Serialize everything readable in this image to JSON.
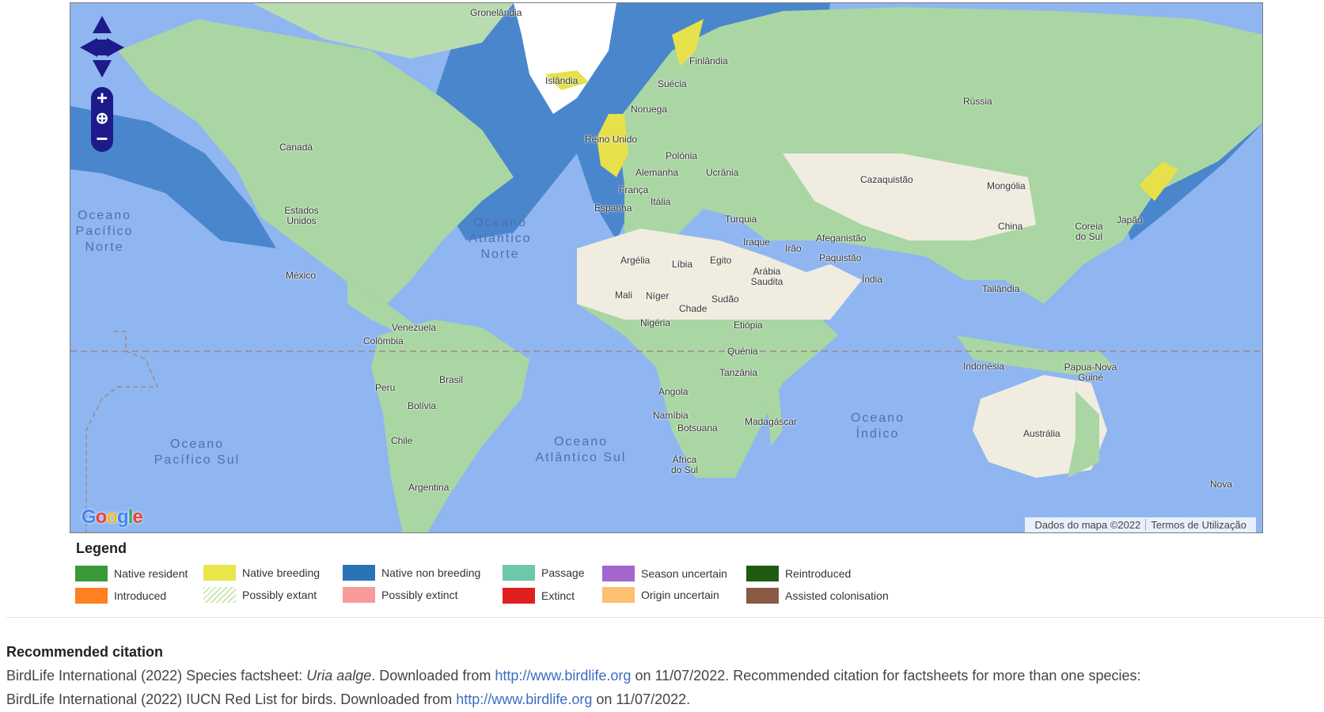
{
  "map": {
    "countries": [
      "Gronelândia",
      "Islândia",
      "Finlândia",
      "Suécia",
      "Noruega",
      "Reino Unido",
      "Polónia",
      "Alemanha",
      "Ucrânia",
      "França",
      "Itália",
      "Espanha",
      "Rússia",
      "Cazaquistão",
      "Mongólia",
      "China",
      "Coreia do Sul",
      "Japão",
      "Turquia",
      "Iraque",
      "Irão",
      "Afeganistão",
      "Paquistão",
      "Arábia Saudita",
      "Índia",
      "Tailândia",
      "Egito",
      "Argélia",
      "Líbia",
      "Mali",
      "Níger",
      "Chade",
      "Sudão",
      "Nigéria",
      "Etiópia",
      "Quénia",
      "Tanzânia",
      "Angola",
      "Namíbia",
      "Botsuana",
      "África do Sul",
      "Madagáscar",
      "Indonésia",
      "Papua-Nova Guiné",
      "Austrália",
      "Nova",
      "Canadá",
      "Estados Unidos",
      "México",
      "Venezuela",
      "Colômbia",
      "Brasil",
      "Peru",
      "Bolívia",
      "Chile",
      "Argentina"
    ],
    "oceans": [
      "Oceano\nPacífico\nNorte",
      "Oceano\nAtlântico\nNorte",
      "Oceano\nPacífico Sul",
      "Oceano\nAtlântico Sul",
      "Oceano\nÍndico"
    ],
    "controls": {
      "zoom_in": "+",
      "zoom_out": "−",
      "world": "⊕"
    },
    "google_logo": [
      "G",
      "o",
      "o",
      "g",
      "l",
      "e"
    ],
    "google_colors": [
      "#4285F4",
      "#EA4335",
      "#FBBC05",
      "#4285F4",
      "#34A853",
      "#EA4335"
    ],
    "attribution": [
      "Dados do mapa ©2022",
      "Termos de Utilização"
    ],
    "colors": {
      "water": "#8fb6f0",
      "land": "#a9d6a3",
      "desert": "#f1ece0",
      "ice": "#ffffff",
      "range_non_breeding": "#4a86cc",
      "range_breeding": "#e6e04a"
    }
  },
  "legend": {
    "title": "Legend",
    "items": [
      {
        "label": "Native resident",
        "color": "#3a9a3a"
      },
      {
        "label": "Native breeding",
        "color": "#e8e64a"
      },
      {
        "label": "Native non breeding",
        "color": "#2a74b6"
      },
      {
        "label": "Passage",
        "color": "#6cc8a8"
      },
      {
        "label": "Season uncertain",
        "color": "#a366cc"
      },
      {
        "label": "Reintroduced",
        "color": "#1f5a12"
      },
      {
        "label": "Introduced",
        "color": "#ff8020"
      },
      {
        "label": "Possibly extant",
        "color": "hatch"
      },
      {
        "label": "Possibly extinct",
        "color": "#f99a9a"
      },
      {
        "label": "Extinct",
        "color": "#e02020"
      },
      {
        "label": "Origin uncertain",
        "color": "#ffbf70"
      },
      {
        "label": "Assisted colonisation",
        "color": "#8a5a44"
      }
    ]
  },
  "citation": {
    "title": "Recommended citation",
    "line1_a": "BirdLife International (2022) Species factsheet: ",
    "line1_species": "Uria aalge",
    "line1_b": ". Downloaded from ",
    "link": "http://www.birdlife.org",
    "line1_c": " on 11/07/2022. Recommended citation for factsheets for more than one species:",
    "line2_a": "BirdLife International (2022) IUCN Red List for birds. Downloaded from ",
    "line2_c": " on 11/07/2022."
  }
}
